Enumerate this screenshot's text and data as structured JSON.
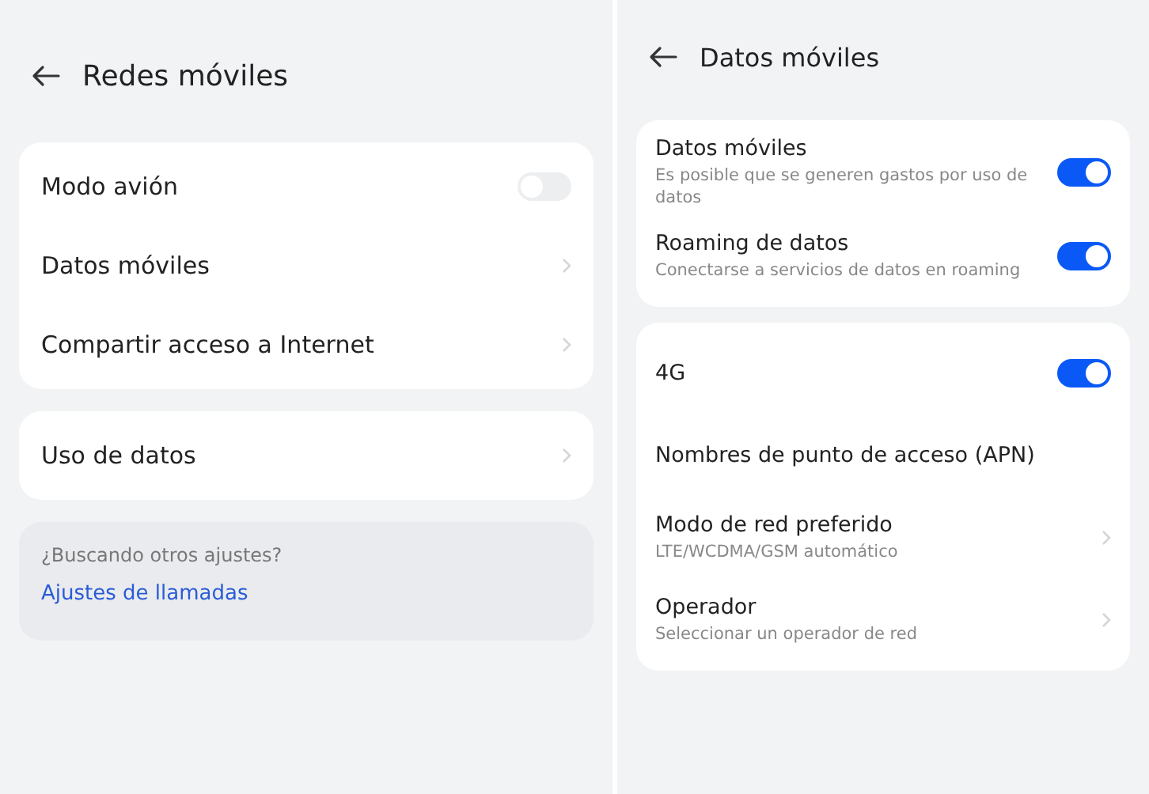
{
  "screens": [
    {
      "title": "Redes móviles",
      "groups": [
        {
          "items": [
            {
              "label": "Modo avión",
              "kind": "toggle",
              "on": false
            },
            {
              "label": "Datos móviles",
              "kind": "link"
            },
            {
              "label": "Compartir acceso a Internet",
              "kind": "link"
            }
          ]
        },
        {
          "items": [
            {
              "label": "Uso de datos",
              "kind": "link"
            }
          ]
        }
      ],
      "suggestions": {
        "prompt": "¿Buscando otros ajustes?",
        "link": "Ajustes de llamadas"
      }
    },
    {
      "title": "Datos móviles",
      "groups": [
        {
          "items": [
            {
              "label": "Datos móviles",
              "sublabel": "Es posible que se generen gastos por uso de datos",
              "kind": "toggle",
              "on": true
            },
            {
              "label": "Roaming de datos",
              "sublabel": "Conectarse a servicios de datos en roaming",
              "kind": "toggle",
              "on": true
            }
          ]
        },
        {
          "items": [
            {
              "label": "4G",
              "kind": "toggle",
              "on": true
            },
            {
              "label": "Nombres de punto de acceso (APN)",
              "kind": "plain"
            },
            {
              "label": "Modo de red preferido",
              "sublabel": "LTE/WCDMA/GSM automático",
              "kind": "link"
            },
            {
              "label": "Operador",
              "sublabel": "Seleccionar un operador de red",
              "kind": "link"
            }
          ]
        }
      ]
    }
  ]
}
